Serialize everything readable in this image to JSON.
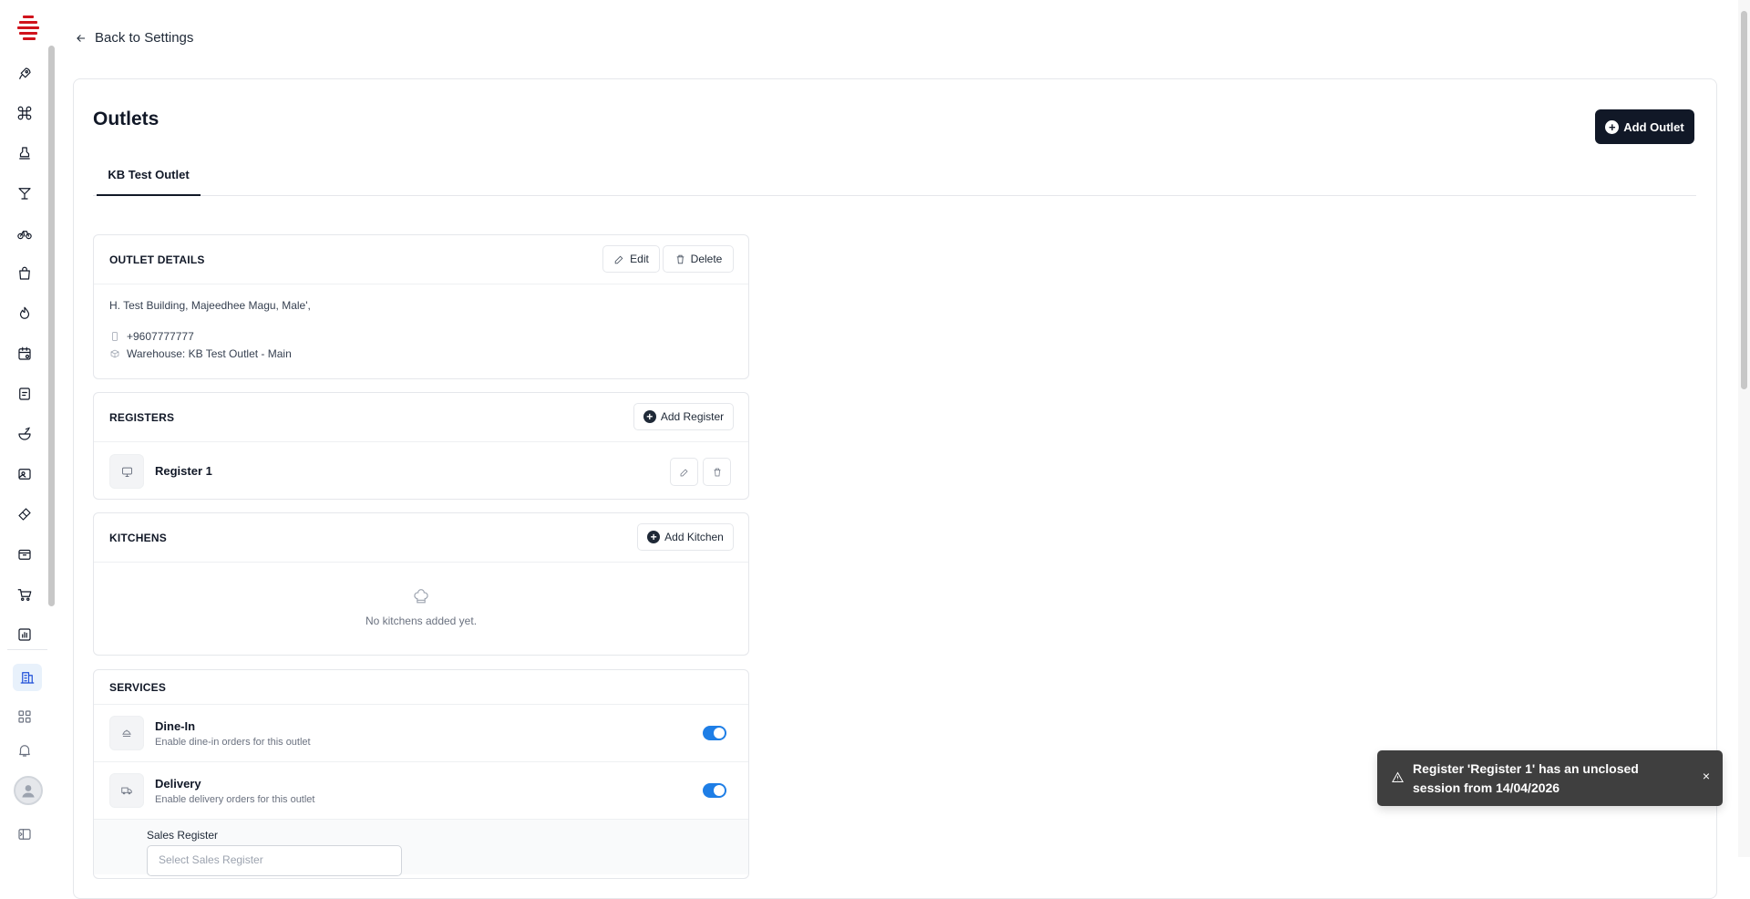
{
  "sidebar": {
    "nav_icons": [
      "rocket-icon",
      "command-icon",
      "stamp-icon",
      "cocktail-icon",
      "bicycle-icon",
      "shopping-bag-icon",
      "flame-icon",
      "calendar-gear-icon",
      "receipt-icon",
      "bowl-icon",
      "image-gear-icon",
      "ticket-icon",
      "package-icon",
      "cart-icon",
      "chart-icon",
      "building-icon",
      "grid-icon",
      "bell-icon",
      "avatar",
      "panel-icon"
    ]
  },
  "back_link": {
    "label": "Back to Settings"
  },
  "page": {
    "title": "Outlets",
    "add_outlet_label": "Add Outlet",
    "tabs": [
      {
        "label": "KB Test Outlet",
        "active": true
      }
    ]
  },
  "outlet_details": {
    "title": "OUTLET DETAILS",
    "edit_label": "Edit",
    "delete_label": "Delete",
    "address": "H. Test Building, Majeedhee Magu, Male',",
    "phone": "+9607777777",
    "warehouse": "Warehouse: KB Test Outlet - Main"
  },
  "registers": {
    "title": "REGISTERS",
    "add_label": "Add Register",
    "items": [
      {
        "name": "Register 1"
      }
    ]
  },
  "kitchens": {
    "title": "KITCHENS",
    "add_label": "Add Kitchen",
    "empty_text": "No kitchens added yet."
  },
  "services": {
    "title": "SERVICES",
    "items": [
      {
        "name": "Dine-In",
        "description": "Enable dine-in orders for this outlet",
        "enabled": true
      },
      {
        "name": "Delivery",
        "description": "Enable delivery orders for this outlet",
        "enabled": true
      }
    ],
    "sales_register_label": "Sales Register",
    "sales_register_placeholder": "Select Sales Register"
  },
  "toast": {
    "message": "Register 'Register 1' has an unclosed session from 14/04/2026",
    "close_label": "×"
  },
  "colors": {
    "primary_dark": "#111827",
    "accent_blue": "#1e7ee6",
    "logo_red": "#d0131c",
    "toast_bg": "#3f3f3f"
  }
}
